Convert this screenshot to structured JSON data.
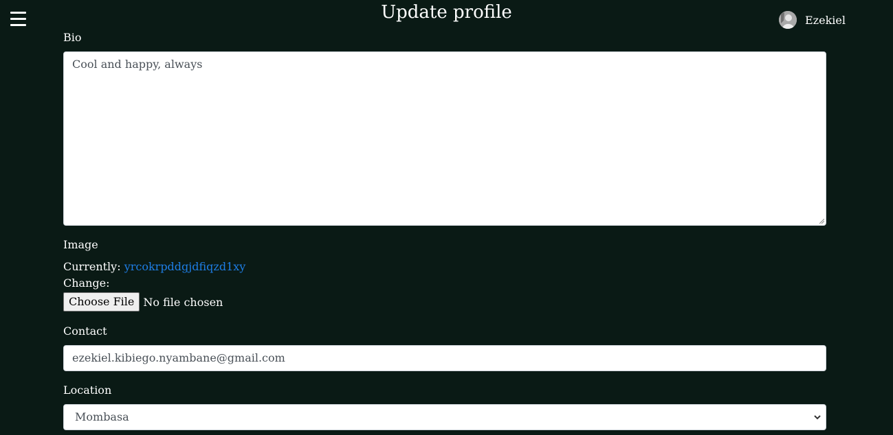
{
  "header": {
    "menu_icon": "hamburger-menu-icon",
    "title": "Update profile",
    "user": {
      "name": "Ezekiel",
      "avatar_icon": "user-avatar"
    }
  },
  "form": {
    "bio": {
      "label": "Bio",
      "value": "Cool and happy, always"
    },
    "image": {
      "label": "Image",
      "currently_label": "Currently:",
      "current_file": "yrcokrpddgjdfiqzd1xy",
      "change_label": "Change:",
      "choose_button": "Choose File",
      "file_status": "No file chosen"
    },
    "contact": {
      "label": "Contact",
      "value": "ezekiel.kibiego.nyambane@gmail.com"
    },
    "location": {
      "label": "Location",
      "selected": "Mombasa"
    }
  },
  "colors": {
    "background": "#0a1a15",
    "link": "#1e7ee6",
    "input_text": "#495057"
  }
}
